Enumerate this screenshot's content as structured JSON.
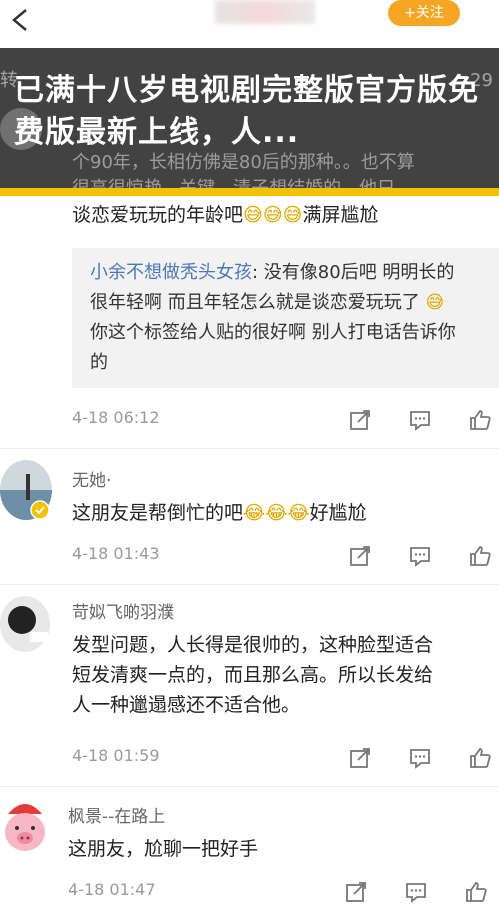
{
  "header": {
    "follow_label": "+关注",
    "under_text_left": "转",
    "under_text_right": "29",
    "behind_line1": "个90年，长相仿佛是80后的那种。。也不算",
    "behind_line2": "很高很惊艳...关键，清子想结婚的，他只"
  },
  "overlay": {
    "title": "已满十八岁电视剧完整版官方版免费版最新上线，人..."
  },
  "comments": [
    {
      "text_line1": "谈恋爱玩玩的年龄吧",
      "text_line1_suffix": "满屏尴尬",
      "quote": {
        "author": "小余不想做秃头女孩",
        "line1": ": 没有像80后吧 明明长的",
        "line2": "很年轻啊 而且年轻怎么就是谈恋爱玩玩了",
        "line3": "你这个标签给人贴的很好啊 别人打电话告诉你",
        "line4": "的"
      },
      "time": "4-18 06:12"
    },
    {
      "author": "无她·",
      "text": "这朋友是帮倒忙的吧",
      "text_suffix": "好尴尬",
      "time": "4-18 01:43"
    },
    {
      "author": "苛姒飞啲羽濮",
      "line1": "发型问题，人长得是很帅的，这种脸型适合",
      "line2": "短发清爽一点的，而且那么高。所以长发给",
      "line3": "人一种邋遢感还不适合他。",
      "time": "4-18 01:59"
    },
    {
      "author": "枫景--在路上",
      "text": "这朋友，尬聊一把好手",
      "time": "4-18 01:47"
    }
  ],
  "emoji": {
    "sweat_smile": "😅",
    "cry_laugh": "😂"
  },
  "colors": {
    "overlay": "#282828",
    "accent_yellow": "#f6c200",
    "follow_orange": "#f5a623",
    "link_blue": "#4a7ab8"
  },
  "icons": [
    "back-arrow-icon",
    "share-icon",
    "comment-icon",
    "like-icon"
  ]
}
